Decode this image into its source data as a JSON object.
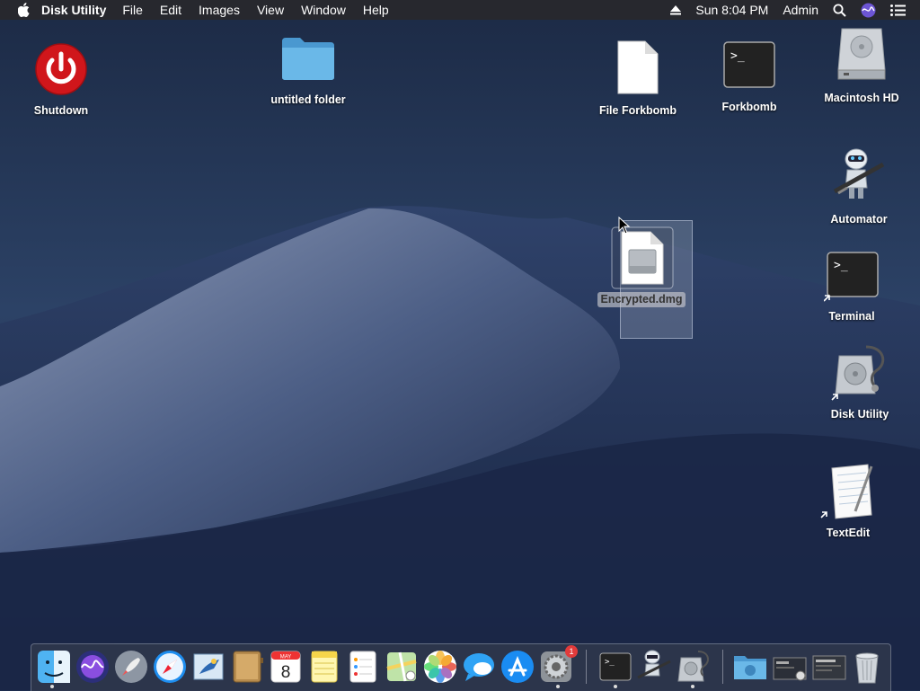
{
  "menubar": {
    "app_name": "Disk Utility",
    "menus": [
      "File",
      "Edit",
      "Images",
      "View",
      "Window",
      "Help"
    ],
    "clock": "Sun 8:04 PM",
    "user": "Admin",
    "icons": [
      "apple-icon",
      "eject-icon",
      "search-icon",
      "siri-icon",
      "menu-list-icon"
    ]
  },
  "desktop": {
    "icons": [
      {
        "label": "Shutdown",
        "icon": "power-icon"
      },
      {
        "label": "untitled folder",
        "icon": "folder-icon"
      },
      {
        "label": "File Forkbomb",
        "icon": "document-icon"
      },
      {
        "label": "Forkbomb",
        "icon": "terminal-script-icon"
      },
      {
        "label": "Macintosh HD",
        "icon": "hard-drive-icon"
      },
      {
        "label": "Automator",
        "icon": "automator-icon"
      },
      {
        "label": "Terminal",
        "icon": "terminal-icon"
      },
      {
        "label": "Disk Utility",
        "icon": "disk-utility-icon"
      },
      {
        "label": "TextEdit",
        "icon": "textedit-icon"
      }
    ],
    "dragged_item": {
      "label": "Encrypted.dmg",
      "icon": "disk-image-icon"
    }
  },
  "dock": {
    "apps": [
      {
        "name": "finder-icon"
      },
      {
        "name": "siri-icon"
      },
      {
        "name": "launchpad-icon"
      },
      {
        "name": "safari-icon"
      },
      {
        "name": "mail-icon"
      },
      {
        "name": "contacts-icon"
      },
      {
        "name": "calendar-icon",
        "month": "MAY",
        "day": "8"
      },
      {
        "name": "notes-icon"
      },
      {
        "name": "reminders-icon"
      },
      {
        "name": "maps-icon"
      },
      {
        "name": "photos-icon"
      },
      {
        "name": "messages-icon"
      },
      {
        "name": "app-store-icon"
      },
      {
        "name": "system-preferences-icon",
        "badge": "1"
      },
      {
        "name": "terminal-icon"
      },
      {
        "name": "automator-icon"
      },
      {
        "name": "disk-utility-icon"
      },
      {
        "name": "downloads-folder-icon"
      },
      {
        "name": "recent-item-icon"
      },
      {
        "name": "recent-item-icon"
      },
      {
        "name": "trash-icon"
      }
    ]
  },
  "colors": {
    "shutdown_red": "#d0161b",
    "folder_blue": "#5aa9dd",
    "badge_red": "#e23b3b"
  }
}
